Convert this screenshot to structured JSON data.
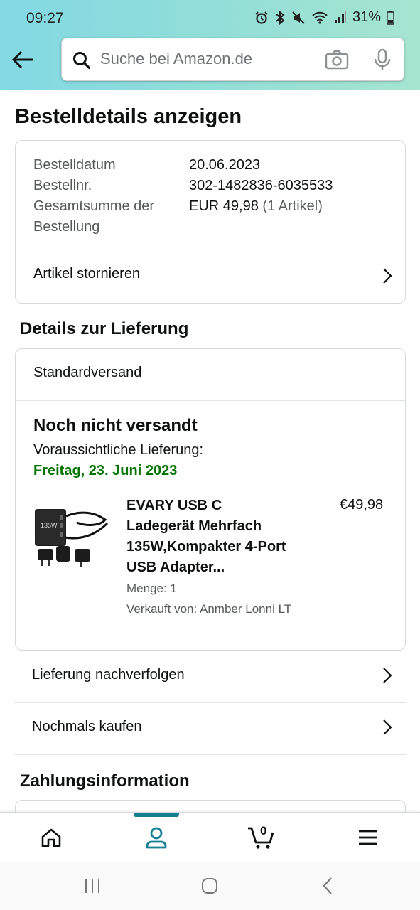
{
  "status_bar": {
    "time": "09:27",
    "battery": "31%",
    "icons": [
      "alarm-icon",
      "bluetooth-icon",
      "mute-icon",
      "wifi-icon",
      "signal-icon",
      "battery-icon"
    ]
  },
  "search": {
    "placeholder": "Suche bei Amazon.de"
  },
  "page": {
    "title": "Bestelldetails anzeigen"
  },
  "order_summary": {
    "date_label": "Bestelldatum",
    "date_value": "20.06.2023",
    "number_label": "Bestellnr.",
    "number_value": "302-1482836-6035533",
    "total_label": "Gesamtsumme der Bestellung",
    "total_value": "EUR 49,98",
    "total_items": "(1 Artikel)",
    "cancel_label": "Artikel stornieren"
  },
  "delivery": {
    "section_title": "Details zur Lieferung",
    "shipping_method": "Standardversand",
    "status": "Noch nicht versandt",
    "estimate_label": "Voraussichtliche Lieferung:",
    "estimate_date": "Freitag, 23. Juni 2023",
    "product": {
      "title": "EVARY USB C Ladegerät Mehrfach 135W,Kompakter 4-Port USB Adapter...",
      "price": "€49,98",
      "quantity": "Menge: 1",
      "seller": "Verkauft von: Anmber Lonni LT",
      "image_text": "135W"
    }
  },
  "actions": {
    "track": "Lieferung nachverfolgen",
    "buy_again": "Nochmals kaufen"
  },
  "payment": {
    "section_title": "Zahlungsinformation"
  },
  "bottom_nav": {
    "items": [
      "home-icon",
      "account-icon",
      "cart-icon",
      "menu-icon"
    ],
    "active": "account-icon",
    "cart_count": "0",
    "accent_color": "#127f92"
  },
  "colors": {
    "delivery_date": "#007600",
    "header_gradient_start": "#82d8e3",
    "header_gradient_end": "#a6e5cf"
  }
}
